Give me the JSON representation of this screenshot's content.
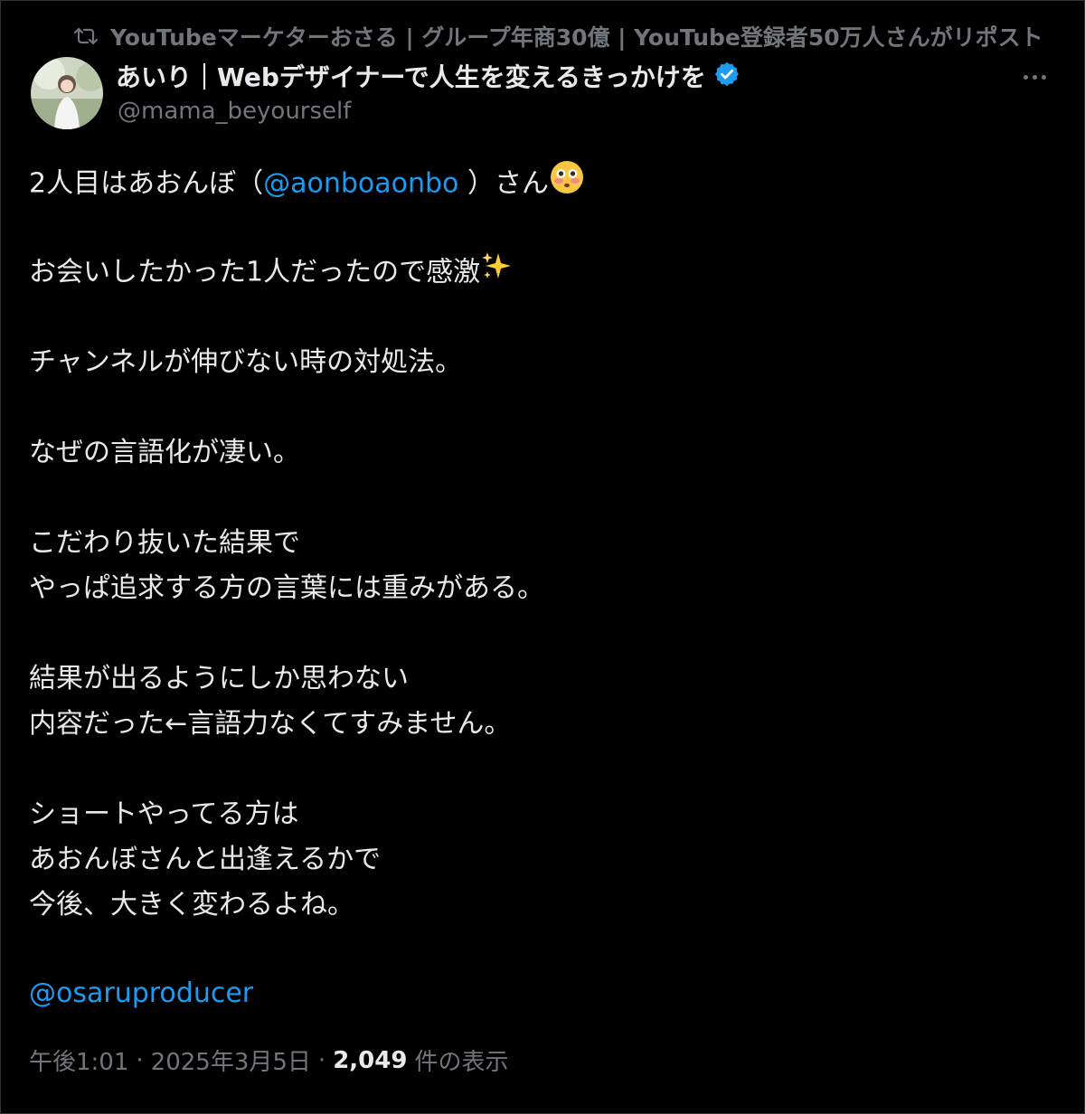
{
  "repost": {
    "icon": "repost-icon",
    "text": "YouTubeマーケターおさる | グループ年商30億 | YouTube登録者50万人さんがリポスト"
  },
  "author": {
    "display_name": "あいり｜Webデザイナーで人生を変えるきっかけを",
    "verified_icon": "verified-badge-icon",
    "handle": "@mama_beyourself"
  },
  "tweet": {
    "line1_prefix": "2人目はあおんぼ（",
    "line1_mention": "@aonboaonbo",
    "line1_suffix": " ）さん",
    "line2": "お会いしたかった1人だったので感激",
    "line3": "チャンネルが伸びない時の対処法。",
    "line4": "なぜの言語化が凄い。",
    "line5a": "こだわり抜いた結果で",
    "line5b": "やっぱ追求する方の言葉には重みがある。",
    "line6a": "結果が出るようにしか思わない",
    "line6b": "内容だった←言語力なくてすみません。",
    "line7a": "ショートやってる方は",
    "line7b": "あおんぼさんと出逢えるかで",
    "line7c": "今後、大きく変わるよね。",
    "mention_footer": "@osaruproducer"
  },
  "meta": {
    "time": "午後1:01",
    "date": "2025年3月5日",
    "separator": "·",
    "views_count": "2,049",
    "views_label": "件の表示"
  },
  "colors": {
    "background": "#000000",
    "text": "#e7e9ea",
    "muted": "#71767b",
    "link": "#1d9bf0",
    "verified": "#1d9bf0"
  }
}
